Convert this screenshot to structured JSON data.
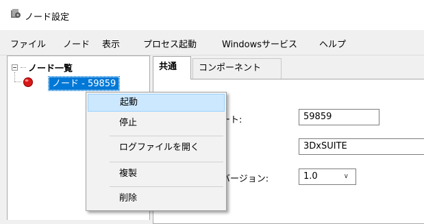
{
  "window": {
    "title": "ノード設定",
    "icon": "app-settings-icon"
  },
  "menubar": {
    "items": [
      "ファイル",
      "ノード",
      "表示",
      "プロセス起動",
      "Windowsサービス",
      "ヘルプ"
    ]
  },
  "tree": {
    "root_label": "ノード一覧",
    "child_label": "ノード - 59859",
    "child_icon": "red-node-icon",
    "root_state": "expanded"
  },
  "tabs": {
    "common": "共通",
    "component": "コンポーネント"
  },
  "form": {
    "port_label_partial": "ート:",
    "port_value": "59859",
    "name_value": "3DxSUITE",
    "version_label_partial": "バージョン:",
    "version_value": "1.0"
  },
  "context_menu": {
    "items": [
      "起動",
      "停止",
      "ログファイルを開く",
      "複製",
      "削除"
    ],
    "highlighted": "起動"
  },
  "colors": {
    "selection": "#0078d7",
    "menu_highlight": "#cce8ff"
  }
}
